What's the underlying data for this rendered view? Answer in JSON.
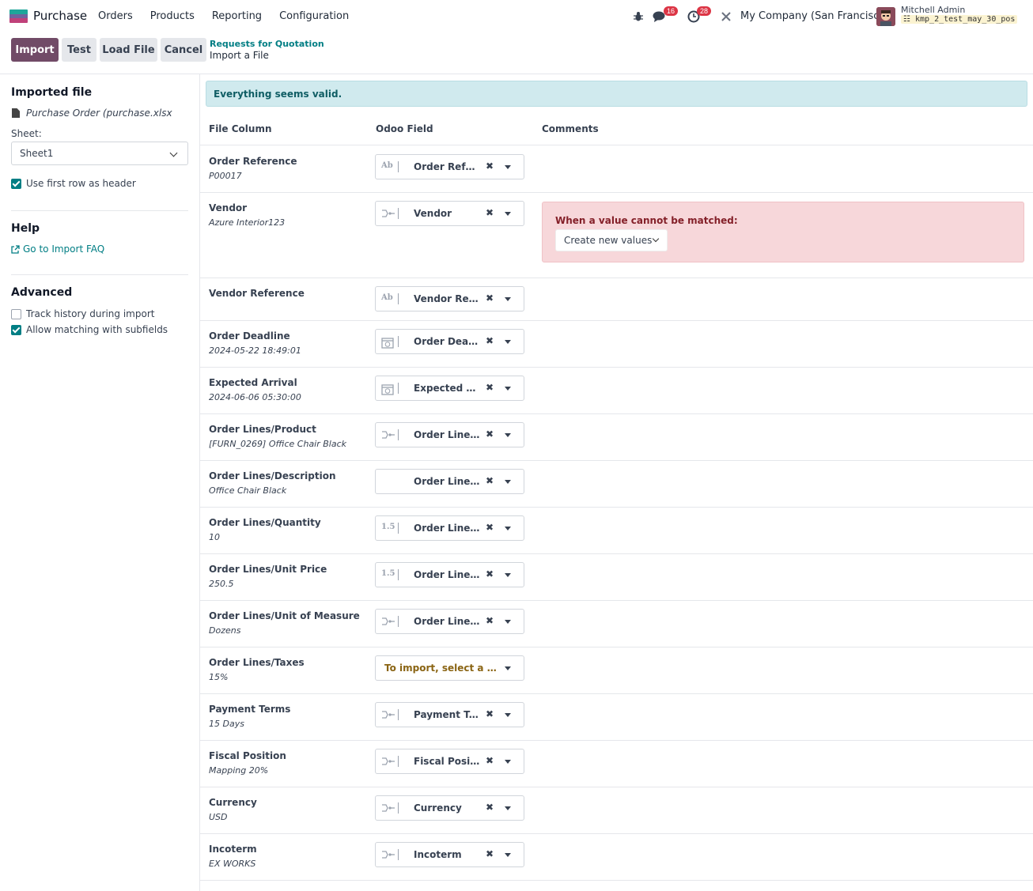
{
  "nav": {
    "app_name": "Purchase",
    "menu": [
      "Orders",
      "Products",
      "Reporting",
      "Configuration"
    ],
    "messages_count": "16",
    "activities_count": "28",
    "company": "My Company (San Francisco)",
    "user_name": "Mitchell Admin",
    "database": "kmp_2_test_may_30_pos"
  },
  "toolbar": {
    "import_label": "Import",
    "test_label": "Test",
    "load_file_label": "Load File",
    "cancel_label": "Cancel"
  },
  "breadcrumb": {
    "parent": "Requests for Quotation",
    "current": "Import a File"
  },
  "sidebar": {
    "imported_file_title": "Imported file",
    "file_name": "Purchase Order (purchase.xlsx",
    "sheet_label": "Sheet:",
    "sheet_value": "Sheet1",
    "use_first_row_label": "Use first row as header",
    "help_title": "Help",
    "faq_link": "Go to Import FAQ",
    "advanced_title": "Advanced",
    "track_history_label": "Track history during import",
    "allow_matching_label": "Allow matching with subfields"
  },
  "main": {
    "alert": "Everything seems valid.",
    "headers": {
      "file_column": "File Column",
      "odoo_field": "Odoo Field",
      "comments": "Comments"
    },
    "vendor_comment": {
      "title": "When a value cannot be matched:",
      "option": "Create new values"
    },
    "rows": [
      {
        "name": "Order Reference",
        "sample": "P00017",
        "field": "Order Reference",
        "icon": "Ab"
      },
      {
        "name": "Vendor",
        "sample": "Azure Interior123",
        "field": "Vendor",
        "icon": "relation"
      },
      {
        "name": "Vendor Reference",
        "sample": "",
        "field": "Vendor Reference",
        "icon": "Ab"
      },
      {
        "name": "Order Deadline",
        "sample": "2024-05-22 18:49:01",
        "field": "Order Deadline",
        "icon": "calendar"
      },
      {
        "name": "Expected Arrival",
        "sample": "2024-06-06 05:30:00",
        "field": "Expected Arrival",
        "icon": "calendar"
      },
      {
        "name": "Order Lines/Product",
        "sample": "[FURN_0269] Office Chair Black",
        "field": "Order Lines / Product",
        "icon": "relation"
      },
      {
        "name": "Order Lines/Description",
        "sample": "Office Chair Black",
        "field": "Order Lines / Description",
        "icon": ""
      },
      {
        "name": "Order Lines/Quantity",
        "sample": "10",
        "field": "Order Lines / Quantity",
        "icon": "1.5"
      },
      {
        "name": "Order Lines/Unit Price",
        "sample": "250.5",
        "field": "Order Lines / Unit Price",
        "icon": "1.5"
      },
      {
        "name": "Order Lines/Unit of Measure",
        "sample": "Dozens",
        "field": "Order Lines / Unit of Measure",
        "icon": "relation"
      },
      {
        "name": "Order Lines/Taxes",
        "sample": "15%",
        "field": "To import, select a field...",
        "icon": "none"
      },
      {
        "name": "Payment Terms",
        "sample": "15 Days",
        "field": "Payment Terms",
        "icon": "relation"
      },
      {
        "name": "Fiscal Position",
        "sample": "Mapping 20%",
        "field": "Fiscal Position",
        "icon": "relation"
      },
      {
        "name": "Currency",
        "sample": "USD",
        "field": "Currency",
        "icon": "relation"
      },
      {
        "name": "Incoterm",
        "sample": "EX WORKS",
        "field": "Incoterm",
        "icon": "relation"
      }
    ]
  }
}
